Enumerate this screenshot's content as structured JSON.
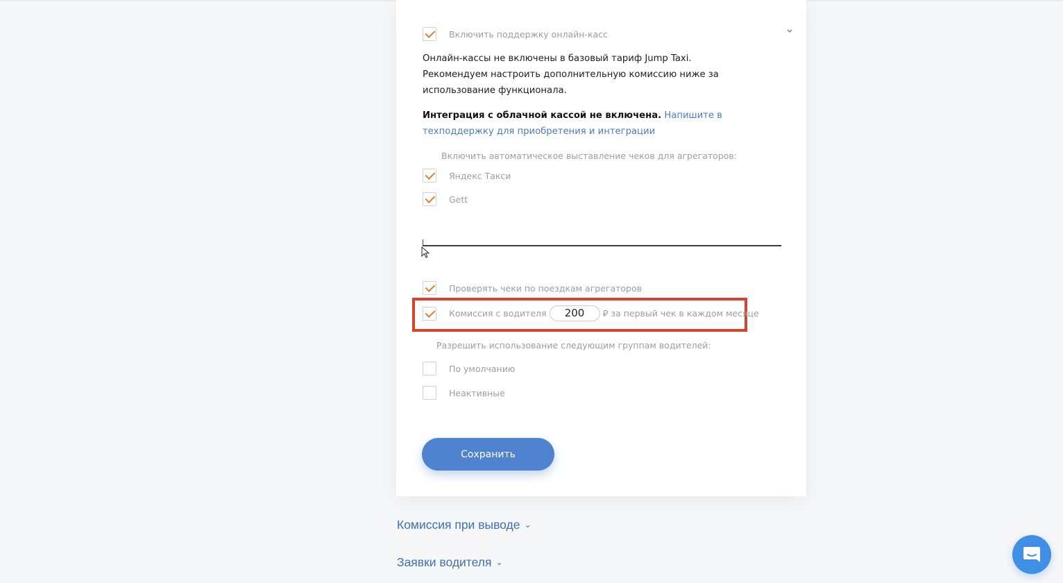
{
  "online_cash": {
    "toggle_label": "Включить поддержку онлайн-касс",
    "toggle_checked": true,
    "expand_icon": "chevron-down-icon",
    "info_line1": "Онлайн-кассы не включены в базовый тариф Jump Taxi.",
    "info_line2": "Рекомендуем настроить дополнительную комиссию ниже за использование функционала.",
    "integration_bold": "Интеграция с облачной кассой не включена.",
    "integration_link": "Напишите в техподдержку для приобретения и интеграции",
    "aggregators_hint": "Включить автоматическое выставление чеков для агрегаторов:",
    "aggregators": [
      {
        "label": "Яндекс Такси",
        "checked": true
      },
      {
        "label": "Gett",
        "checked": true
      }
    ],
    "verify_receipts_label": "Проверять чеки по поездкам агрегаторов",
    "verify_receipts_checked": true,
    "commission": {
      "checked": true,
      "label": "Комиссия с водителя",
      "value": "200",
      "suffix": "₽ за первый чек в каждом месяце"
    },
    "groups_hint": "Разрешить использование следующим группам водителей:",
    "groups": [
      {
        "label": "По умолчанию",
        "checked": false
      },
      {
        "label": "Неактивные",
        "checked": false
      }
    ],
    "save_label": "Сохранить"
  },
  "sections": [
    {
      "label": "Комиссия при выводе"
    },
    {
      "label": "Заявки водителя"
    }
  ],
  "colors": {
    "accent_blue": "#4f82cf",
    "check_orange": "#e07b2d",
    "highlight_red": "#d9422b",
    "link_blue": "#4a7bc4"
  },
  "chat_icon": "chat-bubble-icon"
}
